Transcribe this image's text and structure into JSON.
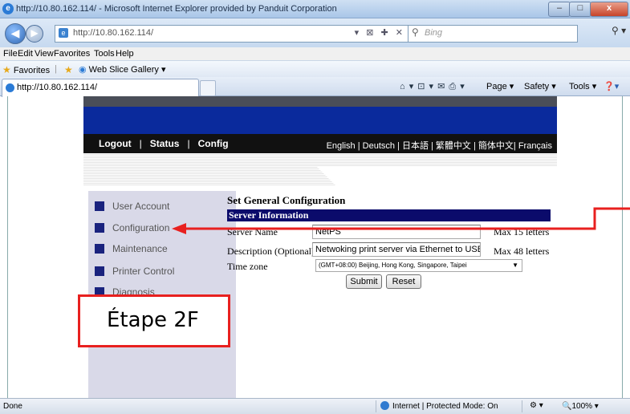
{
  "window": {
    "title": "http://10.80.162.114/ - Microsoft Internet Explorer provided by Panduit Corporation",
    "minimize": "–",
    "maximize": "□",
    "close": "x"
  },
  "address": {
    "url": "http://10.80.162.114/",
    "search_placeholder": "Bing",
    "tools": "▾ ⊠ ✚ ✕"
  },
  "menu": [
    "File",
    "Edit",
    "View",
    "Favorites",
    "Tools",
    "Help"
  ],
  "favorites": {
    "label": "Favorites",
    "web_slice": "Web Slice Gallery ▾"
  },
  "tab": {
    "title": "http://10.80.162.114/"
  },
  "commands": {
    "page": "Page ▾",
    "safety": "Safety ▾",
    "tools": "Tools ▾",
    "help": "❓▾",
    "icons": "⌂ ▾  ⊡ ▾  ✉  ⎙ ▾"
  },
  "site_nav": {
    "logout": "Logout",
    "status": "Status",
    "config": "Config",
    "separator": "|",
    "languages": "English | Deutsch | 日本語 | 繁體中文 | 簡体中文| Français"
  },
  "sidebar": {
    "items": [
      {
        "label": "User Account"
      },
      {
        "label": "Configuration"
      },
      {
        "label": "Maintenance"
      },
      {
        "label": "Printer Control"
      },
      {
        "label": "Diagnosis"
      }
    ]
  },
  "form": {
    "title": "Set General Configuration",
    "section": "Server Information",
    "server_name_label": "Server Name",
    "server_name_value": "NetPS",
    "server_name_note": "Max 15 letters",
    "description_label": "Description (Optional)",
    "description_value": "Netwoking print server via Ethernet to USB",
    "description_note": "Max 48 letters",
    "timezone_label": "Time zone",
    "timezone_value": "(GMT+08:00) Beijing, Hong Kong, Singapore, Taipei",
    "submit": "Submit",
    "reset": "Reset"
  },
  "annotation": {
    "step": "Étape 2F",
    "color": "#e8201f"
  },
  "status": {
    "left": "Done",
    "zone": "Internet | Protected Mode: On",
    "zoom": "🔍100%  ▾"
  },
  "colors": {
    "banner": "#0a2a9c",
    "section": "#0b0b6b",
    "sidebar": "#d9d9e8"
  }
}
